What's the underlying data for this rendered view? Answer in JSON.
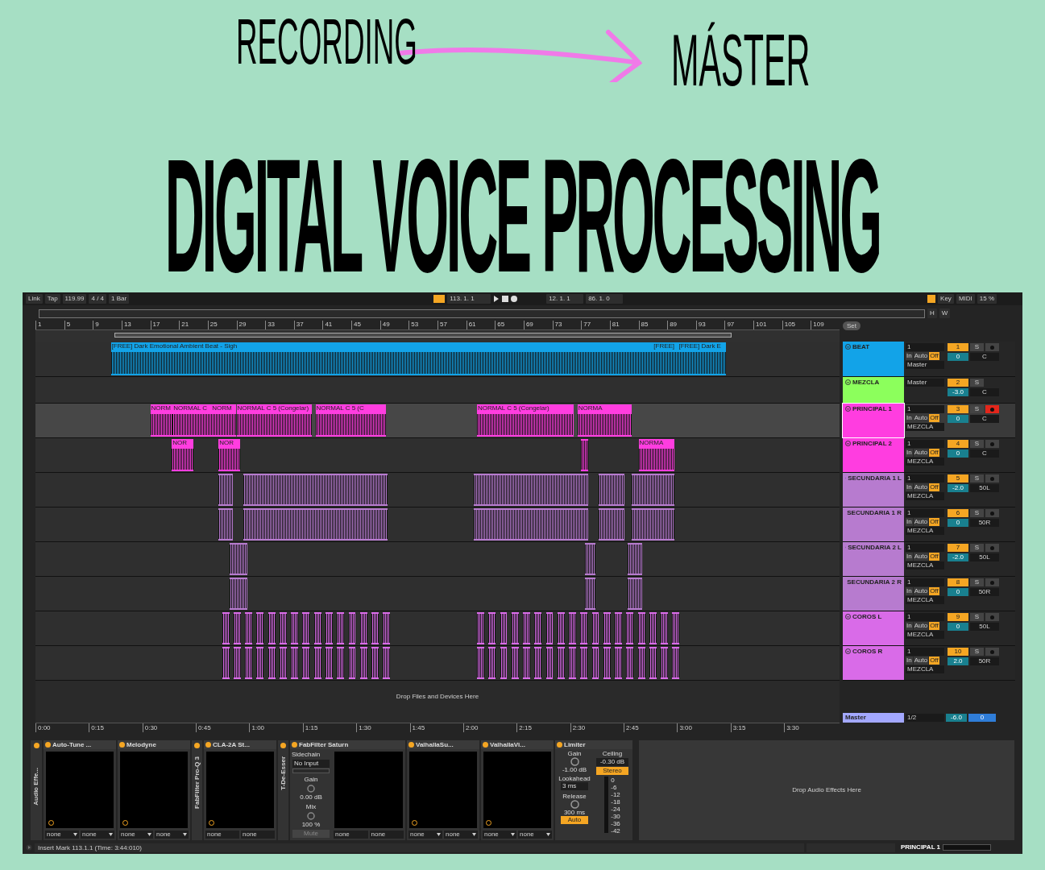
{
  "poster": {
    "label_left": "RECORDING",
    "label_right": "MÁSTER",
    "title": "DIGITAL VOICE PROCESSING"
  },
  "control_bar": {
    "link": "Link",
    "tap": "Tap",
    "tempo": "119.99",
    "signature": "4 / 4",
    "quantize": "1 Bar",
    "position": "113.  1.  1",
    "loop_start": "12.  1.  1",
    "loop_length": "86.  1.  0",
    "key": "Key",
    "midi": "MIDI",
    "cpu": "15 %"
  },
  "overview": {
    "buttons": [
      "H",
      "W"
    ]
  },
  "ruler": {
    "bars": [
      "1",
      "5",
      "9",
      "13",
      "17",
      "21",
      "25",
      "29",
      "33",
      "37",
      "41",
      "45",
      "49",
      "53",
      "57",
      "61",
      "65",
      "69",
      "73",
      "77",
      "81",
      "85",
      "89",
      "93",
      "97",
      "101",
      "105",
      "109"
    ],
    "set": "Set"
  },
  "tracks": [
    {
      "name": "BEAT",
      "kind": "audio",
      "color": "#12a3e8",
      "selected": false,
      "input": "1",
      "monitor": [
        {
          "label": "In",
          "selected": false
        },
        {
          "label": "Auto",
          "selected": false
        },
        {
          "label": "Off",
          "selected": true
        }
      ],
      "output": "Master",
      "number": "1",
      "solo": "S",
      "armed": false,
      "volume": "0",
      "pan": "C",
      "clips": [
        "[FREE] Dark Emotional Ambient Beat - Sigh",
        "[FREE]",
        "[FREE] Dark E"
      ]
    },
    {
      "name": "MEZCLA",
      "kind": "group",
      "color": "#8cff5c",
      "selected": false,
      "output": "Master",
      "number": "2",
      "solo": "S",
      "volume": "-3.0",
      "pan": "C"
    },
    {
      "name": "PRINCIPAL 1",
      "kind": "audio",
      "color": "#ff3de0",
      "selected": true,
      "input": "1",
      "monitor": [
        {
          "label": "In",
          "selected": false
        },
        {
          "label": "Auto",
          "selected": false
        },
        {
          "label": "Off",
          "selected": true
        }
      ],
      "output": "MEZCLA",
      "number": "3",
      "solo": "S",
      "armed": true,
      "volume": "0",
      "pan": "C",
      "clips": [
        "NORM",
        "NORMAL C",
        "NORM",
        "NORMAL C 5 (Congelar)",
        "NORMAL C 5 (C",
        "NORMAL C 5 (Congelar)",
        "NORMA"
      ]
    },
    {
      "name": "PRINCIPAL 2",
      "kind": "audio",
      "color": "#ff3de0",
      "selected": false,
      "input": "1",
      "monitor": [
        {
          "label": "In",
          "selected": false
        },
        {
          "label": "Auto",
          "selected": false
        },
        {
          "label": "Off",
          "selected": true
        }
      ],
      "output": "MEZCLA",
      "number": "4",
      "solo": "S",
      "armed": false,
      "volume": "0",
      "pan": "C",
      "clips": [
        "NOR",
        "NOR",
        "NORMA"
      ]
    },
    {
      "name": "SECUNDARIA 1 L",
      "kind": "audio",
      "color": "#b77bcf",
      "selected": false,
      "input": "1",
      "monitor": [
        {
          "label": "In",
          "selected": false
        },
        {
          "label": "Auto",
          "selected": false
        },
        {
          "label": "Off",
          "selected": true
        }
      ],
      "output": "MEZCLA",
      "number": "5",
      "solo": "S",
      "armed": false,
      "volume": "-2.0",
      "pan": "50L"
    },
    {
      "name": "SECUNDARIA 1 R",
      "kind": "audio",
      "color": "#b77bcf",
      "selected": false,
      "input": "1",
      "monitor": [
        {
          "label": "In",
          "selected": false
        },
        {
          "label": "Auto",
          "selected": false
        },
        {
          "label": "Off",
          "selected": true
        }
      ],
      "output": "MEZCLA",
      "number": "6",
      "solo": "S",
      "armed": false,
      "volume": "0",
      "pan": "50R"
    },
    {
      "name": "SECUNDARIA 2 L",
      "kind": "audio",
      "color": "#b77bcf",
      "selected": false,
      "input": "1",
      "monitor": [
        {
          "label": "In",
          "selected": false
        },
        {
          "label": "Auto",
          "selected": false
        },
        {
          "label": "Off",
          "selected": true
        }
      ],
      "output": "MEZCLA",
      "number": "7",
      "solo": "S",
      "armed": false,
      "volume": "-2.0",
      "pan": "50L"
    },
    {
      "name": "SECUNDARIA 2 R",
      "kind": "audio",
      "color": "#b77bcf",
      "selected": false,
      "input": "1",
      "monitor": [
        {
          "label": "In",
          "selected": false
        },
        {
          "label": "Auto",
          "selected": false
        },
        {
          "label": "Off",
          "selected": true
        }
      ],
      "output": "MEZCLA",
      "number": "8",
      "solo": "S",
      "armed": false,
      "volume": "0",
      "pan": "50R"
    },
    {
      "name": "COROS L",
      "kind": "audio",
      "color": "#d96be8",
      "selected": false,
      "input": "1",
      "monitor": [
        {
          "label": "In",
          "selected": false
        },
        {
          "label": "Auto",
          "selected": false
        },
        {
          "label": "Off",
          "selected": true
        }
      ],
      "output": "MEZCLA",
      "number": "9",
      "solo": "S",
      "armed": false,
      "volume": "0",
      "pan": "50L"
    },
    {
      "name": "COROS R",
      "kind": "audio",
      "color": "#d96be8",
      "selected": false,
      "input": "1",
      "monitor": [
        {
          "label": "In",
          "selected": false
        },
        {
          "label": "Auto",
          "selected": false
        },
        {
          "label": "Off",
          "selected": true
        }
      ],
      "output": "MEZCLA",
      "number": "10",
      "solo": "S",
      "armed": false,
      "volume": "2.0",
      "pan": "50R"
    }
  ],
  "drop_hint": "Drop Files and Devices Here",
  "master": {
    "name": "Master",
    "output": "1/2",
    "volume": "-6.0",
    "pan": "0"
  },
  "time_ruler": [
    "0:00",
    "0:15",
    "0:30",
    "0:45",
    "1:00",
    "1:15",
    "1:30",
    "1:45",
    "2:00",
    "2:15",
    "2:30",
    "2:45",
    "3:00",
    "3:15",
    "3:30"
  ],
  "devices": [
    {
      "kind": "rack",
      "title": "Audio Effe..."
    },
    {
      "kind": "plugin",
      "title": "Auto-Tune ...",
      "selectors": [
        "none",
        "none"
      ],
      "dropdowns": true
    },
    {
      "kind": "plugin",
      "title": "Melodyne",
      "selectors": [
        "none",
        "none"
      ],
      "dropdowns": true
    },
    {
      "kind": "folded",
      "title": "FabFilter Pro-Q 3"
    },
    {
      "kind": "plugin",
      "title": "CLA-2A St...",
      "selectors": [
        "none",
        "none"
      ],
      "dropdowns": false
    },
    {
      "kind": "folded",
      "title": "T-De-Esser"
    },
    {
      "kind": "saturn",
      "title": "FabFilter Saturn",
      "sidechain": "Sidechain",
      "input": "No Input",
      "gain_label": "Gain",
      "gain": "0.00 dB",
      "mix_label": "Mix",
      "mix": "100 %",
      "mute": "Mute",
      "selectors": [
        "none",
        "none"
      ],
      "dropdowns": false
    },
    {
      "kind": "plugin",
      "title": "ValhallaSu...",
      "selectors": [
        "none",
        "none"
      ],
      "dropdowns": true
    },
    {
      "kind": "plugin",
      "title": "ValhallaVi...",
      "selectors": [
        "none",
        "none"
      ],
      "dropdowns": true
    },
    {
      "kind": "limiter",
      "title": "Limiter",
      "gain_label": "Gain",
      "gain": "-1.00 dB",
      "ceiling_label": "Ceiling",
      "ceiling": "-0.30 dB",
      "stereo": "Stereo",
      "lookahead_label": "Lookahead",
      "lookahead": "3 ms",
      "release_label": "Release",
      "release": "300 ms",
      "auto": "Auto",
      "scale": [
        "0",
        "-6",
        "-12",
        "-18",
        "-24",
        "-30",
        "-36",
        "-42"
      ]
    }
  ],
  "device_drop_hint": "Drop Audio Effects Here",
  "status_bar": {
    "message": "Insert Mark 113.1.1 (Time: 3:44:010)",
    "track": "PRINCIPAL 1"
  }
}
